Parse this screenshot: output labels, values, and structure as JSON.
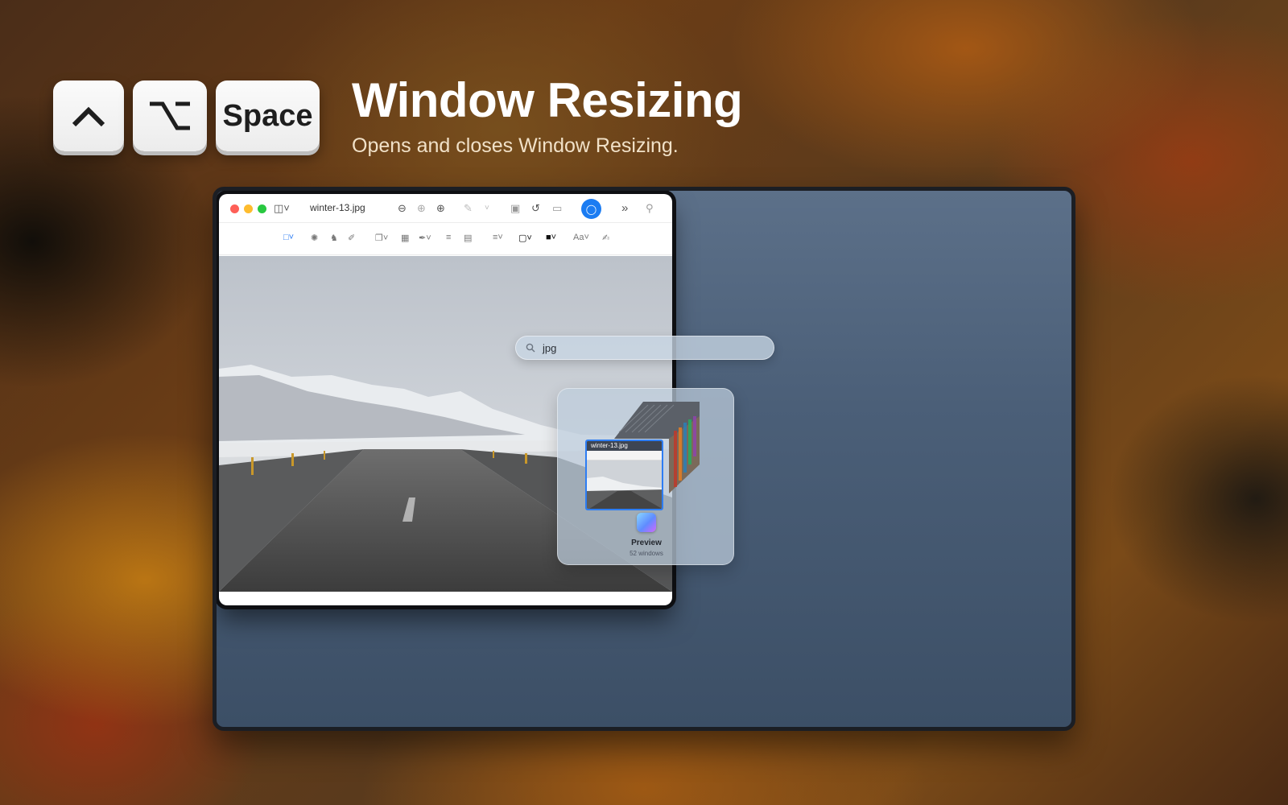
{
  "shortcut": {
    "keys": [
      {
        "name": "control",
        "icon": "caret-up-icon"
      },
      {
        "name": "option",
        "icon": "option-key-icon"
      },
      {
        "name": "space",
        "label": "Space"
      }
    ]
  },
  "header": {
    "title": "Window Resizing",
    "subtitle": "Opens and closes Window Resizing."
  },
  "window": {
    "filename": "winter-13.jpg",
    "toolbar_icons": [
      "sidebar-icon",
      "zoom-out-icon",
      "zoom-fit-icon",
      "zoom-in-icon",
      "markup-pen-icon",
      "chevron-down-icon",
      "crop-icon",
      "rotate-icon",
      "share-icon",
      "autofill-icon",
      "more-icon",
      "search-icon"
    ],
    "markup_icons": [
      "selection-icon",
      "instant-alpha-icon",
      "sketch-icon",
      "draw-icon",
      "shapes-icon",
      "text-icon",
      "sign-icon",
      "adjust-color-icon",
      "page-layout-icon",
      "line-style-icon",
      "border-color-icon",
      "fill-color-icon",
      "text-style-icon",
      "notes-icon"
    ],
    "text_style_label": "Aa"
  },
  "search": {
    "query": "jpg"
  },
  "switcher": {
    "thumbnail_title": "winter-13.jpg",
    "app_name": "Preview",
    "window_count": "52 windows"
  },
  "colors": {
    "accent": "#1b7cf2",
    "selection": "#2d7df3"
  }
}
